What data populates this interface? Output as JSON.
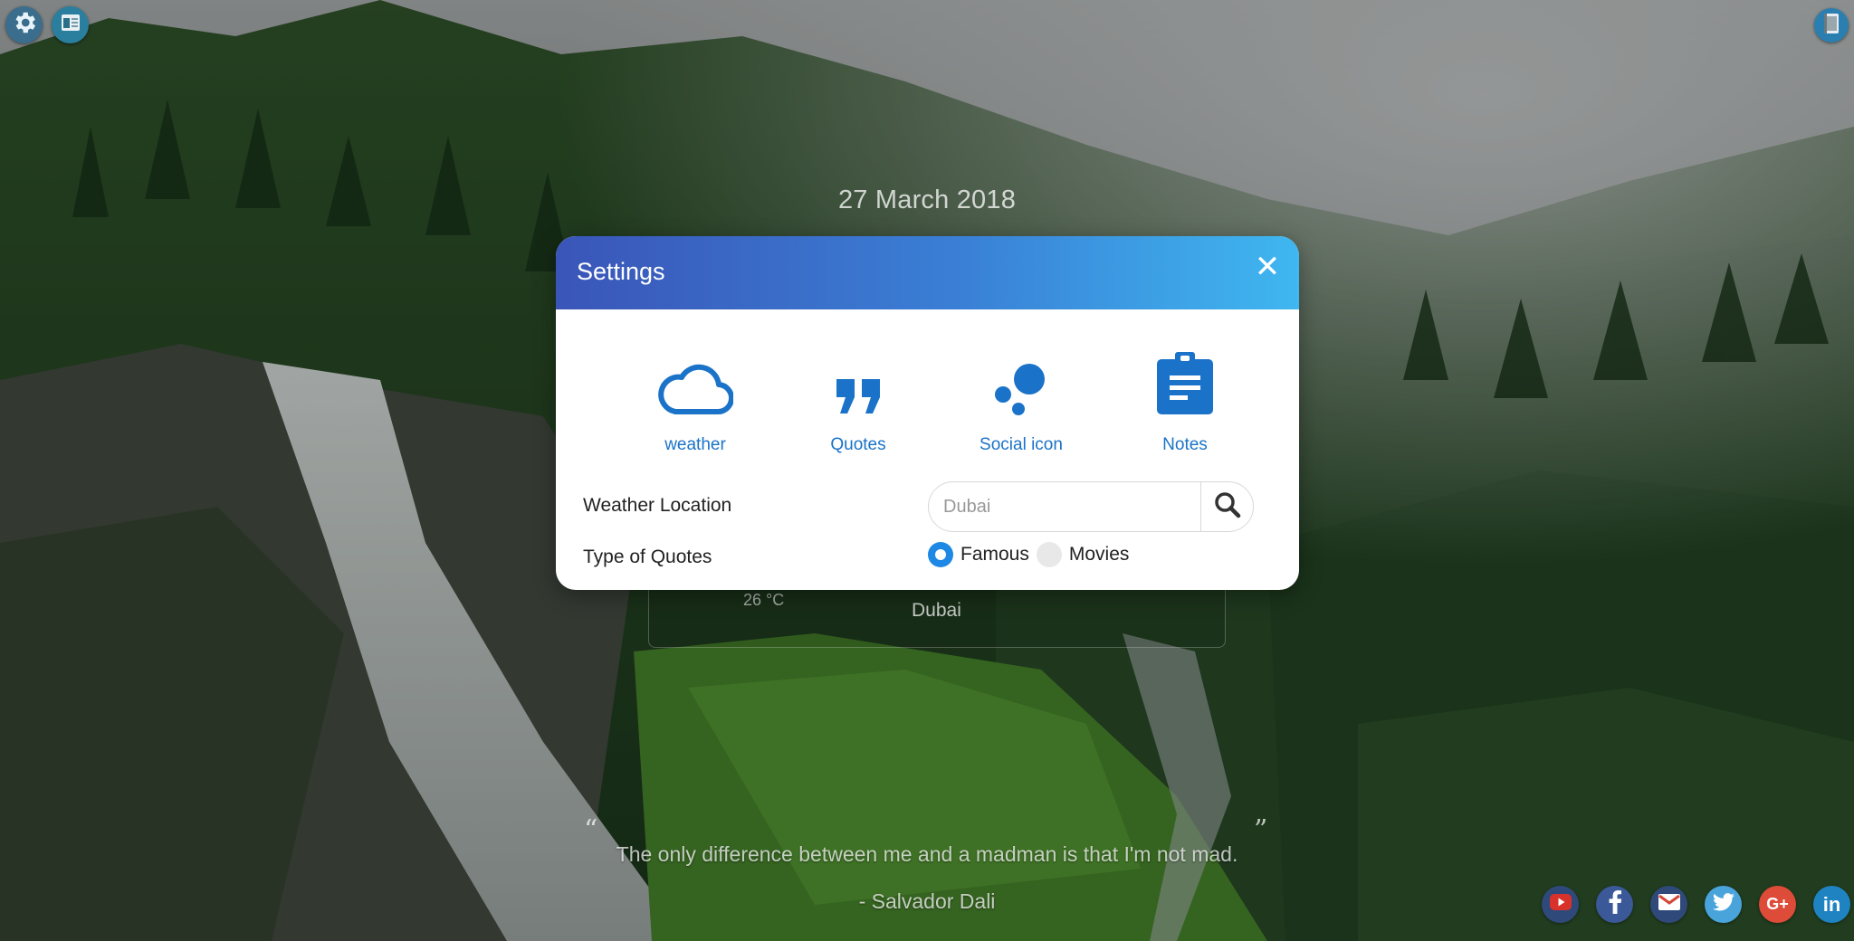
{
  "toolbar": {
    "settings_icon": "gear-icon",
    "layout_icon": "window-layout-icon",
    "notes_icon": "notebook-icon"
  },
  "dashboard": {
    "date": "27 March 2018",
    "weather": {
      "temperature": "26 °C",
      "city": "Dubai"
    },
    "quote": {
      "open_mark": "“",
      "close_mark": "”",
      "text": "The only difference between me and a madman is that I'm not mad.",
      "author": "- Salvador Dali"
    }
  },
  "social": {
    "items": [
      {
        "name": "youtube",
        "icon": "youtube-icon",
        "color": "#c4302b"
      },
      {
        "name": "facebook",
        "icon": "facebook-icon",
        "color": "#3b5998"
      },
      {
        "name": "gmail",
        "icon": "mail-icon",
        "color": "#d44638"
      },
      {
        "name": "twitter",
        "icon": "twitter-icon",
        "color": "#1da1f2"
      },
      {
        "name": "google-plus",
        "icon": "google-plus-icon",
        "color": "#dd4b39"
      },
      {
        "name": "linkedin",
        "icon": "linkedin-icon",
        "color": "#0077b5"
      }
    ]
  },
  "settings_modal": {
    "title": "Settings",
    "close_glyph": "✕",
    "features": [
      {
        "label": "weather",
        "icon": "cloud-icon"
      },
      {
        "label": "Quotes",
        "icon": "quote-icon"
      },
      {
        "label": "Social icon",
        "icon": "social-dots-icon"
      },
      {
        "label": "Notes",
        "icon": "clipboard-icon"
      }
    ],
    "weather_location": {
      "label": "Weather Location",
      "value": "",
      "placeholder": "Dubai"
    },
    "quotes_type": {
      "label": "Type of Quotes",
      "options": [
        {
          "label": "Famous",
          "selected": true
        },
        {
          "label": "Movies",
          "selected": false
        }
      ]
    },
    "accent_color": "#1a73c8"
  }
}
